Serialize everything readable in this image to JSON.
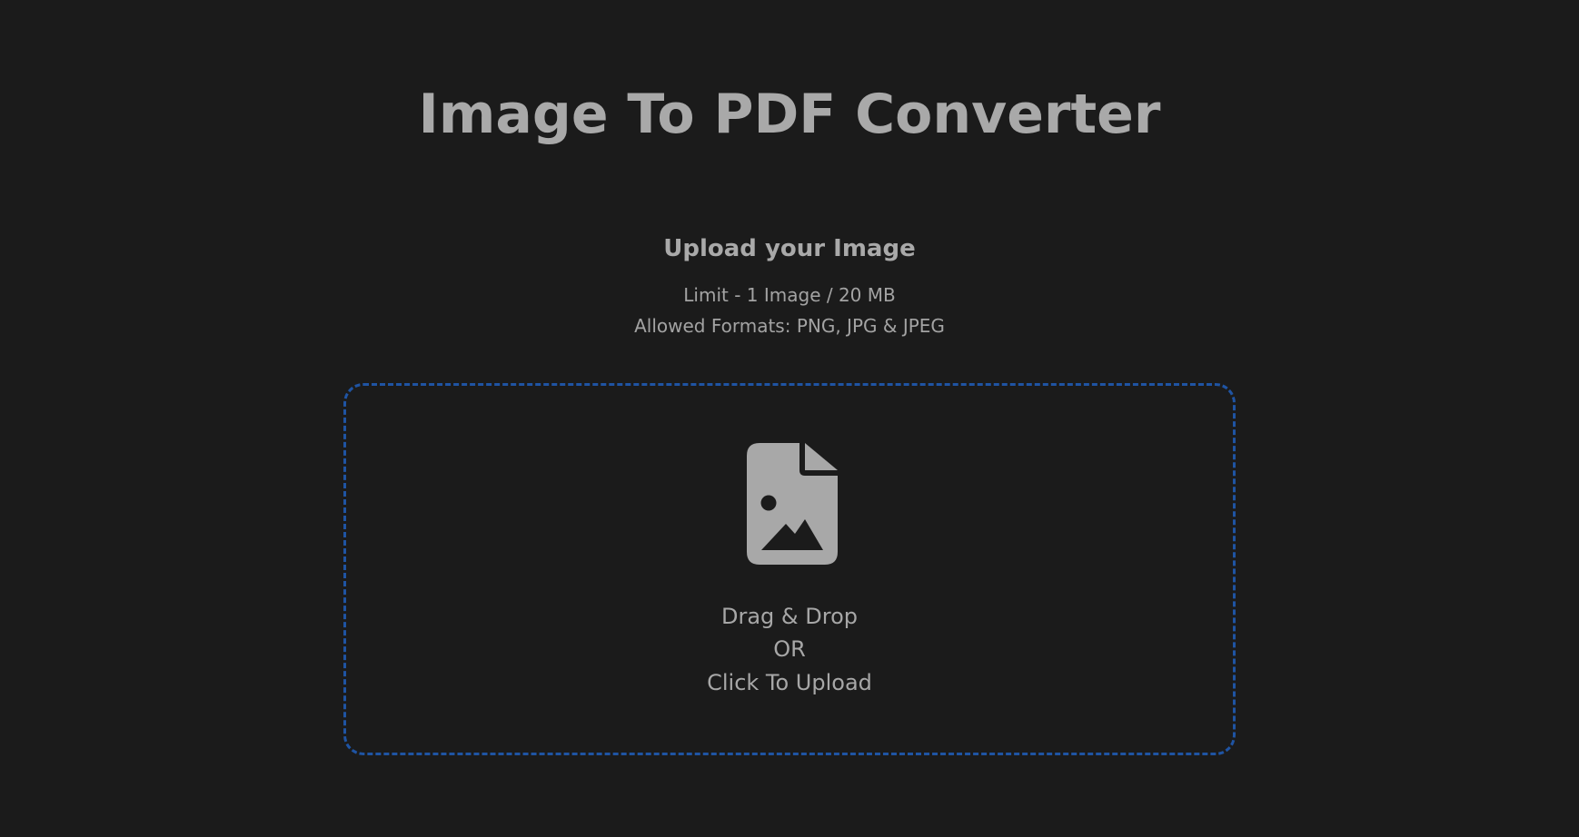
{
  "header": {
    "title": "Image To PDF Converter"
  },
  "upload": {
    "heading": "Upload your Image",
    "limit": "Limit - 1 Image / 20 MB",
    "formats": "Allowed Formats: PNG, JPG & JPEG"
  },
  "drop_zone": {
    "icon": "file-image-icon",
    "line1": "Drag & Drop",
    "line2": "OR",
    "line3": "Click To Upload",
    "border_color": "#1f54a3"
  },
  "colors": {
    "background": "#1b1b1b",
    "text": "#a9a9a9",
    "accent": "#1f54a3"
  }
}
